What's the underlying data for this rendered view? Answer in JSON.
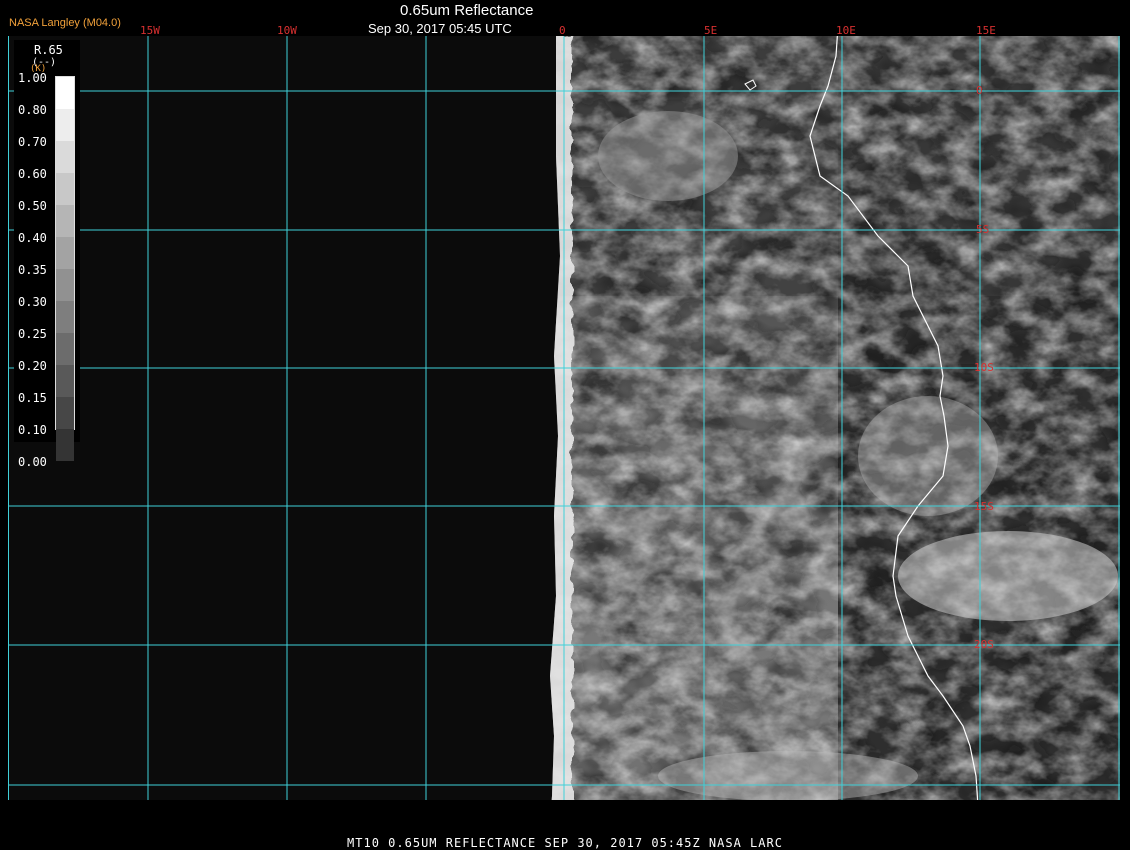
{
  "header": {
    "producer": "NASA Langley (M04.0)",
    "title": "0.65um Reflectance",
    "datetime": "Sep 30, 2017 05:45 UTC"
  },
  "lon_labels": [
    "15W",
    "10W",
    "0",
    "5E",
    "10E",
    "15E"
  ],
  "lat_labels": [
    "0",
    "5S",
    "10S",
    "15S",
    "20S"
  ],
  "legend": {
    "variable": "R.65",
    "unit": "(--)",
    "unit_small": "(K)",
    "levels": [
      "1.00",
      "0.80",
      "0.70",
      "0.60",
      "0.50",
      "0.40",
      "0.35",
      "0.30",
      "0.25",
      "0.20",
      "0.15",
      "0.10",
      "0.00"
    ],
    "colors": [
      "#ffffff",
      "#ededed",
      "#dadada",
      "#c8c8c8",
      "#b5b5b5",
      "#a3a3a3",
      "#919191",
      "#7e7e7e",
      "#6c6c6c",
      "#595959",
      "#474747",
      "#343434",
      "#1e1e1e"
    ]
  },
  "footer": "MT10  0.65UM REFLECTANCE   SEP 30, 2017 05:45Z   NASA LARC",
  "colors": {
    "grid": "#3fd0d8",
    "label_red": "#d83030",
    "coastline": "#ffffff",
    "background": "#0b0b0b",
    "producer": "#f3a23a"
  }
}
